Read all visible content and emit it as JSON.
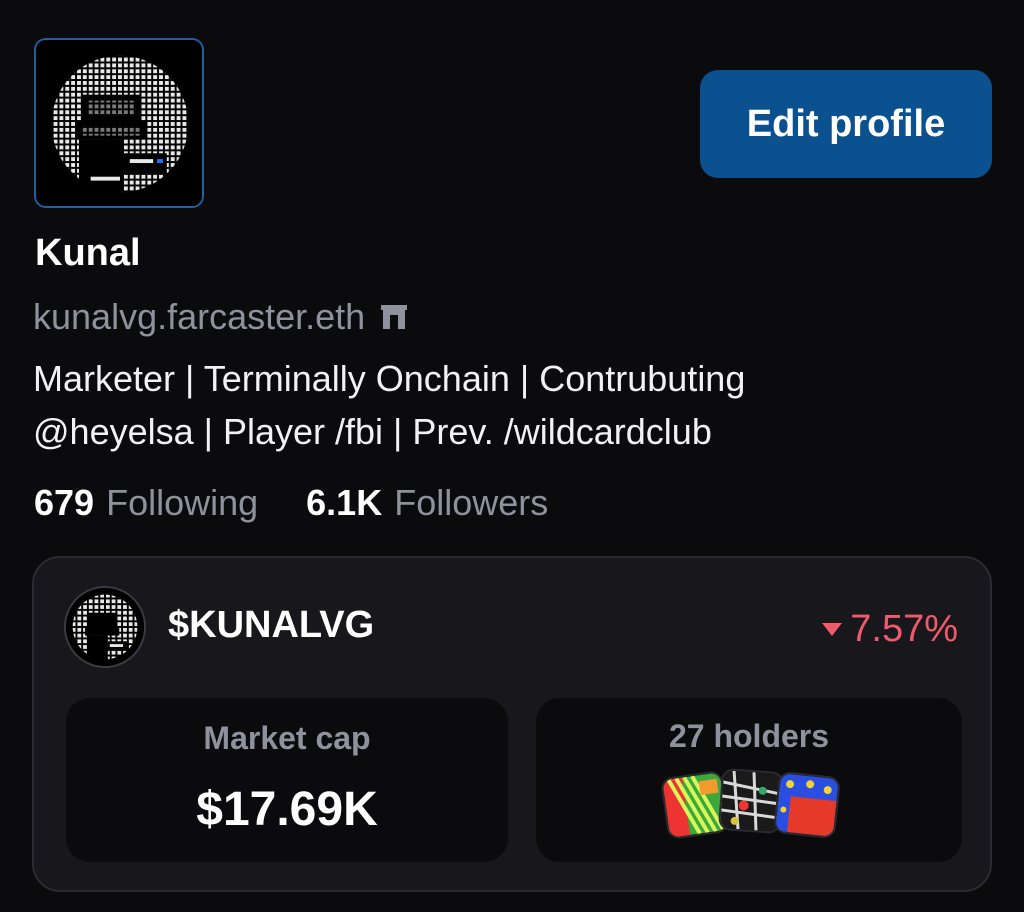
{
  "profile": {
    "display_name": "Kunal",
    "username": "kunalvg.farcaster.eth",
    "bio_lines": [
      "Marketer | Terminally Onchain | Contrubuting",
      "@heyelsa | Player /fbi | Prev. /wildcardclub"
    ],
    "edit_button_label": "Edit profile",
    "avatar_icon": "pixel-portrait-avatar",
    "username_badge_icon": "archway-badge-icon"
  },
  "stats": {
    "following_count": "679",
    "following_label": "Following",
    "followers_count": "6.1K",
    "followers_label": "Followers"
  },
  "token": {
    "ticker": "$KUNALVG",
    "change": "7.57%",
    "change_direction": "down",
    "change_color": "#ef5b6a",
    "market_cap_label": "Market cap",
    "market_cap_value": "$17.69K",
    "holders_label": "27 holders"
  },
  "colors": {
    "accent": "#0b5190",
    "background": "#0b0b0e",
    "card": "#17171c",
    "muted_text": "#8f929c"
  }
}
